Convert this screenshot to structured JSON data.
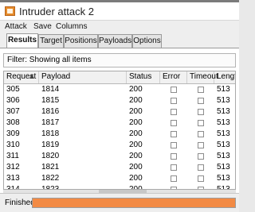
{
  "window": {
    "title": "Intruder attack 2"
  },
  "menu": [
    "Attack",
    "Save",
    "Columns"
  ],
  "tabs": [
    {
      "label": "Results"
    },
    {
      "label": "Target"
    },
    {
      "label": "Positions"
    },
    {
      "label": "Payloads"
    },
    {
      "label": "Options"
    }
  ],
  "filter": {
    "text": "Filter: Showing all items"
  },
  "table": {
    "columns": [
      "Request",
      "Payload",
      "Status",
      "Error",
      "Timeout",
      "Length"
    ],
    "rows": [
      {
        "request": "305",
        "payload": "1814",
        "status": "200",
        "error": false,
        "timeout": false,
        "length": "513"
      },
      {
        "request": "306",
        "payload": "1815",
        "status": "200",
        "error": false,
        "timeout": false,
        "length": "513"
      },
      {
        "request": "307",
        "payload": "1816",
        "status": "200",
        "error": false,
        "timeout": false,
        "length": "513"
      },
      {
        "request": "308",
        "payload": "1817",
        "status": "200",
        "error": false,
        "timeout": false,
        "length": "513"
      },
      {
        "request": "309",
        "payload": "1818",
        "status": "200",
        "error": false,
        "timeout": false,
        "length": "513"
      },
      {
        "request": "310",
        "payload": "1819",
        "status": "200",
        "error": false,
        "timeout": false,
        "length": "513"
      },
      {
        "request": "311",
        "payload": "1820",
        "status": "200",
        "error": false,
        "timeout": false,
        "length": "513"
      },
      {
        "request": "312",
        "payload": "1821",
        "status": "200",
        "error": false,
        "timeout": false,
        "length": "513"
      },
      {
        "request": "313",
        "payload": "1822",
        "status": "200",
        "error": false,
        "timeout": false,
        "length": "513"
      },
      {
        "request": "314",
        "payload": "1823",
        "status": "200",
        "error": false,
        "timeout": false,
        "length": "513"
      }
    ]
  },
  "status": {
    "text": "Finished",
    "progress": 1.0
  },
  "colors": {
    "progress": "#f28a44"
  }
}
